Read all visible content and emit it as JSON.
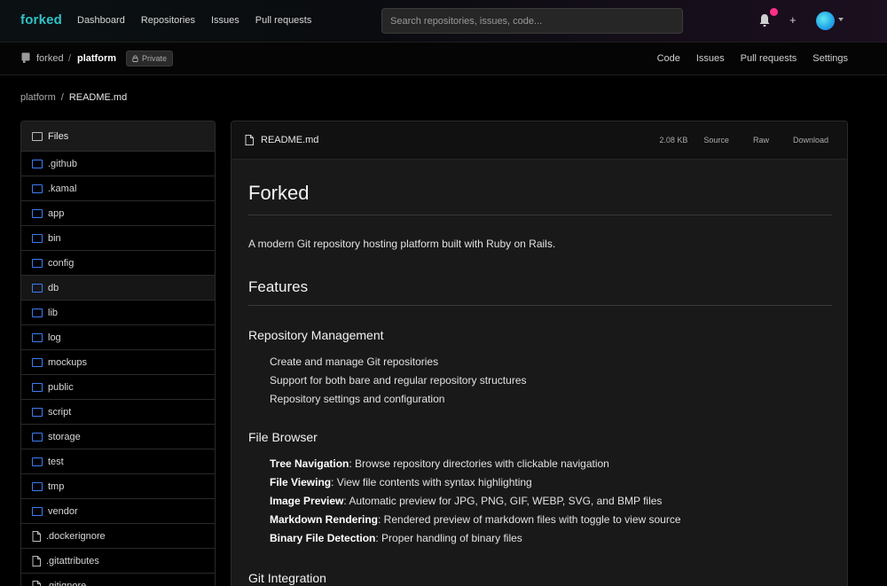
{
  "app": {
    "logo": "forked"
  },
  "nav": {
    "links": [
      "Dashboard",
      "Repositories",
      "Issues",
      "Pull requests"
    ]
  },
  "search": {
    "placeholder": "Search repositories, issues, code..."
  },
  "header_actions": {
    "plus": "+",
    "accent_color": "#ff2e8a"
  },
  "repo": {
    "owner": "forked",
    "separator": "/",
    "name": "platform",
    "visibility": "Private",
    "tabs": [
      "Code",
      "Issues",
      "Pull requests",
      "Settings"
    ]
  },
  "breadcrumb": {
    "root": "platform",
    "separator": "/",
    "current": "README.md"
  },
  "file_tree": {
    "title": "Files",
    "items": [
      {
        "name": ".github",
        "type": "folder"
      },
      {
        "name": ".kamal",
        "type": "folder"
      },
      {
        "name": "app",
        "type": "folder"
      },
      {
        "name": "bin",
        "type": "folder"
      },
      {
        "name": "config",
        "type": "folder"
      },
      {
        "name": "db",
        "type": "folder"
      },
      {
        "name": "lib",
        "type": "folder"
      },
      {
        "name": "log",
        "type": "folder"
      },
      {
        "name": "mockups",
        "type": "folder"
      },
      {
        "name": "public",
        "type": "folder"
      },
      {
        "name": "script",
        "type": "folder"
      },
      {
        "name": "storage",
        "type": "folder"
      },
      {
        "name": "test",
        "type": "folder"
      },
      {
        "name": "tmp",
        "type": "folder"
      },
      {
        "name": "vendor",
        "type": "folder"
      },
      {
        "name": ".dockerignore",
        "type": "file"
      },
      {
        "name": ".gitattributes",
        "type": "file"
      },
      {
        "name": ".gitignore",
        "type": "file"
      }
    ]
  },
  "file_view": {
    "filename": "README.md",
    "size": "2.08 KB",
    "actions": {
      "source": "Source",
      "raw": "Raw",
      "download": "Download"
    }
  },
  "readme": {
    "title": "Forked",
    "description": "A modern Git repository hosting platform built with Ruby on Rails.",
    "features_heading": "Features",
    "sections": [
      {
        "heading": "Repository Management",
        "items": [
          {
            "bold": "",
            "text": "Create and manage Git repositories"
          },
          {
            "bold": "",
            "text": "Support for both bare and regular repository structures"
          },
          {
            "bold": "",
            "text": "Repository settings and configuration"
          }
        ]
      },
      {
        "heading": "File Browser",
        "items": [
          {
            "bold": "Tree Navigation",
            "text": ": Browse repository directories with clickable navigation"
          },
          {
            "bold": "File Viewing",
            "text": ": View file contents with syntax highlighting"
          },
          {
            "bold": "Image Preview",
            "text": ": Automatic preview for JPG, PNG, GIF, WEBP, SVG, and BMP files"
          },
          {
            "bold": "Markdown Rendering",
            "text": ": Rendered preview of markdown files with toggle to view source"
          },
          {
            "bold": "Binary File Detection",
            "text": ": Proper handling of binary files"
          }
        ]
      },
      {
        "heading": "Git Integration",
        "items": []
      }
    ]
  }
}
